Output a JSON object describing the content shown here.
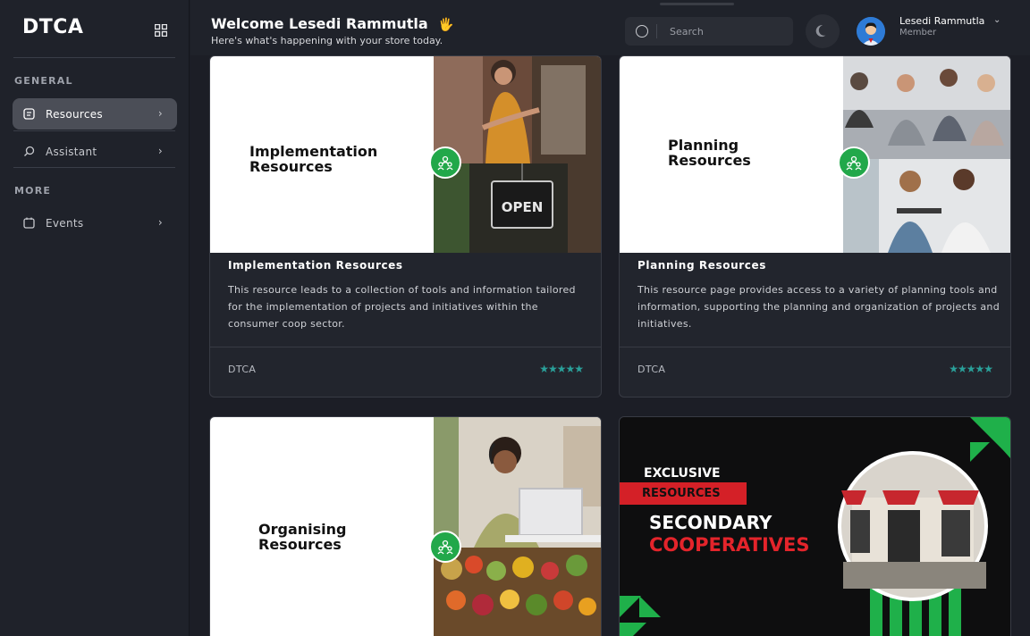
{
  "sidebar": {
    "logo": "DTCA",
    "sections": [
      {
        "label": "GENERAL",
        "items": [
          {
            "label": "Resources",
            "active": true,
            "icon": "document-icon"
          },
          {
            "label": "Assistant",
            "active": false,
            "icon": "assistant-icon"
          }
        ]
      },
      {
        "label": "MORE",
        "items": [
          {
            "label": "Events",
            "active": false,
            "icon": "calendar-icon"
          }
        ]
      }
    ]
  },
  "header": {
    "welcome": "Welcome Lesedi Rammutla",
    "wave_emoji": "🖐",
    "subtitle": "Here's what's happening with your store today.",
    "search_placeholder": "Search",
    "user_name": "Lesedi Rammutla",
    "user_role": "Member",
    "caret": "⌄"
  },
  "cards": [
    {
      "banner_title_line1": "Implementation",
      "banner_title_line2": "Resources",
      "title": "Implementation Resources",
      "description": "This resource leads to a collection of tools and information tailored for the implementation of projects and initiatives within the consumer coop sector.",
      "brand": "DTCA",
      "stars": "★★★★★",
      "rating": 5,
      "sign_text": "OPEN"
    },
    {
      "banner_title_line1": "Planning",
      "banner_title_line2": "Resources",
      "title": "Planning Resources",
      "description": "This resource page provides access to a variety of planning tools and information, supporting the planning and organization of projects and initiatives.",
      "brand": "DTCA",
      "stars": "★★★★★",
      "rating": 5
    },
    {
      "banner_title_line1": "Organising",
      "banner_title_line2": "Resources"
    },
    {
      "promo_line1": "EXCLUSIVE",
      "promo_line2": "RESOURCES",
      "promo_line3": "SECONDARY",
      "promo_line4": "COOPERATIVES"
    }
  ],
  "colors": {
    "accent_green": "#22a84a",
    "star_teal": "#2aa09a",
    "promo_red": "#d42027"
  }
}
